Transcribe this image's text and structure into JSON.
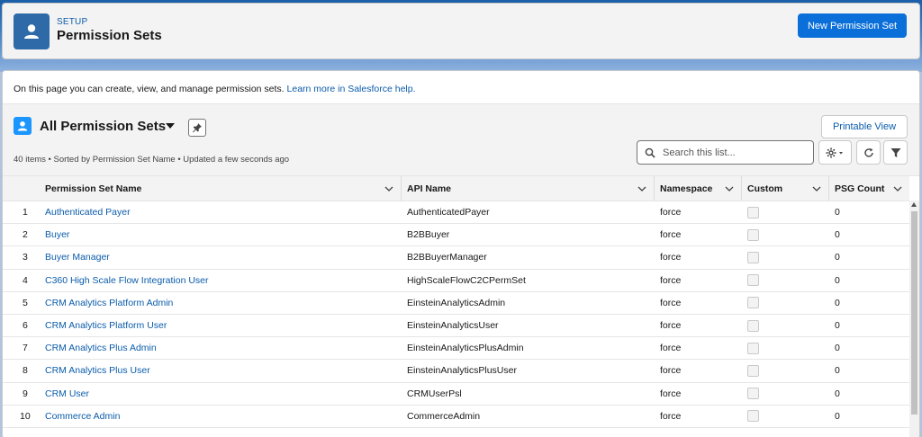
{
  "header": {
    "setup_label": "SETUP",
    "title": "Permission Sets",
    "new_button": "New Permission Set"
  },
  "info": {
    "text": "On this page you can create, view, and manage permission sets. ",
    "link": "Learn more in Salesforce help."
  },
  "list": {
    "title": "All Permission Sets",
    "meta": "40 items • Sorted by Permission Set Name • Updated a few seconds ago",
    "printable_view": "Printable View",
    "search_placeholder": "Search this list..."
  },
  "table": {
    "columns": [
      "Permission Set Name",
      "API Name",
      "Namespace",
      "Custom",
      "PSG Count"
    ],
    "rows": [
      {
        "n": "1",
        "name": "Authenticated Payer",
        "api": "AuthenticatedPayer",
        "ns": "force",
        "psg": "0"
      },
      {
        "n": "2",
        "name": "Buyer",
        "api": "B2BBuyer",
        "ns": "force",
        "psg": "0"
      },
      {
        "n": "3",
        "name": "Buyer Manager",
        "api": "B2BBuyerManager",
        "ns": "force",
        "psg": "0"
      },
      {
        "n": "4",
        "name": "C360 High Scale Flow Integration User",
        "api": "HighScaleFlowC2CPermSet",
        "ns": "force",
        "psg": "0"
      },
      {
        "n": "5",
        "name": "CRM Analytics Platform Admin",
        "api": "EinsteinAnalyticsAdmin",
        "ns": "force",
        "psg": "0"
      },
      {
        "n": "6",
        "name": "CRM Analytics Platform User",
        "api": "EinsteinAnalyticsUser",
        "ns": "force",
        "psg": "0"
      },
      {
        "n": "7",
        "name": "CRM Analytics Plus Admin",
        "api": "EinsteinAnalyticsPlusAdmin",
        "ns": "force",
        "psg": "0"
      },
      {
        "n": "8",
        "name": "CRM Analytics Plus User",
        "api": "EinsteinAnalyticsPlusUser",
        "ns": "force",
        "psg": "0"
      },
      {
        "n": "9",
        "name": "CRM User",
        "api": "CRMUserPsl",
        "ns": "force",
        "psg": "0"
      },
      {
        "n": "10",
        "name": "Commerce Admin",
        "api": "CommerceAdmin",
        "ns": "force",
        "psg": "0"
      }
    ]
  },
  "icons": {
    "header": "user-icon",
    "list": "user-icon",
    "pin": "pin-icon",
    "search": "search-icon",
    "settings": "gear-icon",
    "refresh": "refresh-icon",
    "filter": "filter-icon"
  },
  "colors": {
    "brand": "#0b6fd9",
    "link": "#0b5cab",
    "header_icon": "#2e6aa8",
    "list_icon": "#1b96ff"
  }
}
